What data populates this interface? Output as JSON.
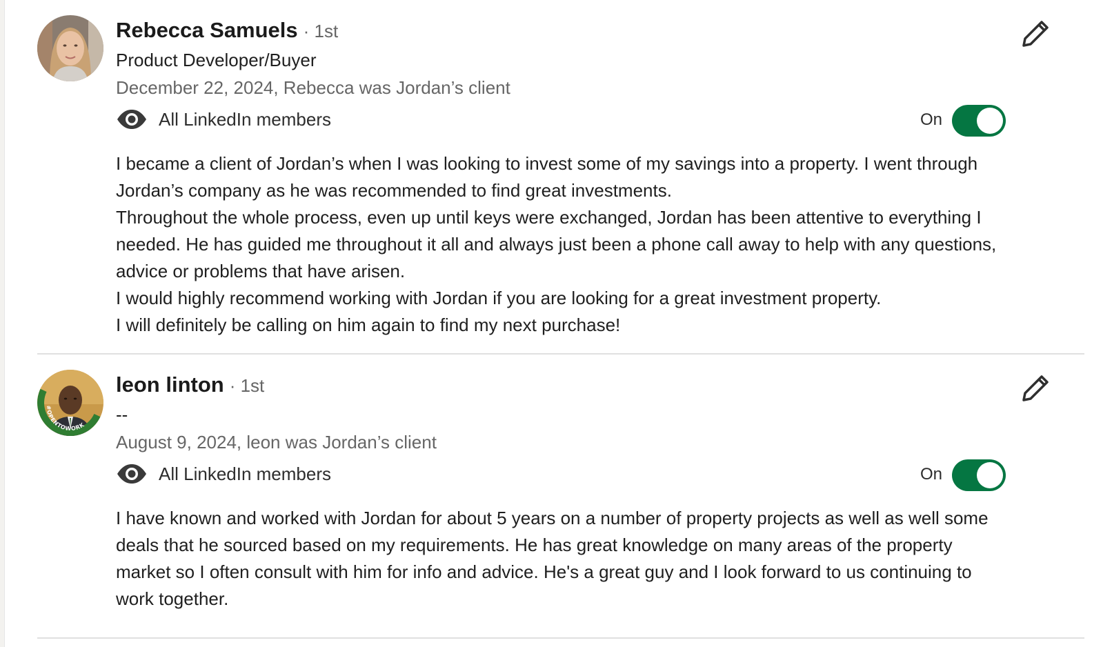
{
  "recommendations": [
    {
      "name": "Rebecca Samuels",
      "degree": "· 1st",
      "headline": "Product Developer/Buyer",
      "meta": "December 22, 2024, Rebecca was Jordan’s client",
      "visibility": "All LinkedIn members",
      "toggle_label": "On",
      "toggle_on": true,
      "avatar_icon": "avatar-photo",
      "paragraphs": [
        "I became a client of Jordan’s when I was looking to invest some of my savings into a property. I went through Jordan’s company as he was recommended to find great investments.",
        "Throughout the whole process, even up until keys were exchanged, Jordan has been attentive to everything I needed. He has guided me throughout it all and always just been a phone call away to help with any questions, advice or problems that have arisen.",
        "I would highly recommend working with Jordan if you are looking for a great investment property.",
        "I will definitely be calling on him again to find my next purchase!"
      ]
    },
    {
      "name": "leon linton",
      "degree": "· 1st",
      "headline": "--",
      "meta": "August 9, 2024, leon was Jordan’s client",
      "visibility": "All LinkedIn members",
      "toggle_label": "On",
      "toggle_on": true,
      "avatar_icon": "avatar-photo-opentowork",
      "avatar_badge": "#OPENTOWORK",
      "paragraphs": [
        "I have known and worked with Jordan for about 5 years on a number of property projects as well as well some deals that he sourced based on my requirements. He has great knowledge on many areas of the property market so I often consult with him for info and advice. He's a great guy and I look forward to us continuing to work together."
      ]
    }
  ],
  "icons": {
    "visibility": "eye-icon",
    "edit": "pencil-icon"
  },
  "colors": {
    "toggle_on": "#057642",
    "muted_text": "#666666",
    "primary_text": "#1f1f1f",
    "open_to_work_ring": "#2f7d32"
  }
}
